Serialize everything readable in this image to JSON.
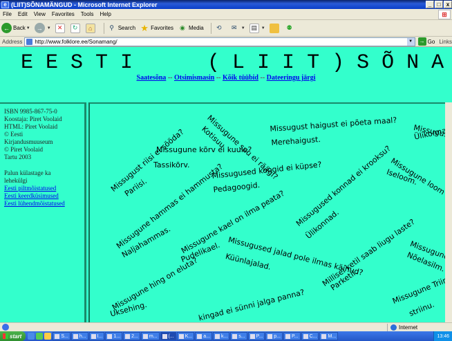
{
  "window": {
    "title": "(LIIT)SÕNAMÄNGUD - Microsoft Internet Explorer",
    "minimize": "_",
    "maximize": "□",
    "close": "x"
  },
  "menu": [
    "File",
    "Edit",
    "View",
    "Favorites",
    "Tools",
    "Help"
  ],
  "toolbar": {
    "back": "Back",
    "search": "Search",
    "favorites": "Favorites",
    "media": "Media"
  },
  "address": {
    "label": "Address",
    "url": "http://www.folklore.ee/Sonamang/",
    "go": "Go",
    "links": "Links"
  },
  "page": {
    "title": "E E S T I      ( L I I T ) S Õ N A M Ä N G U D",
    "nav": [
      {
        "label": "Saatesõna"
      },
      {
        "label": "Otsimismasin"
      },
      {
        "label": "Kõik tüübid"
      },
      {
        "label": "Dateeringu järgi"
      }
    ],
    "nav_separator": " -- "
  },
  "sidebar": {
    "lines": [
      "ISBN 9985-867-75-0",
      "Koostaja: Piret Voolaid",
      "HTML: Piret Voolaid",
      "© Eesti",
      "Kirjandusmuuseum",
      "© Piret Voolaid",
      "Tartu 2003"
    ],
    "note_lines": [
      "Palun külastage ka",
      "lehekülgi"
    ],
    "links": [
      "Eesti piltmõistatused",
      "Eesti keerdküsimused",
      "Eesti lühendmõistatused"
    ]
  },
  "riddles": [
    "Missugust riisi ei sööda?",
    "Pariisi.",
    "Missugune suu ei räägi?",
    "Kotisuu",
    "Missugust haigust ei põeta maal?",
    "Merehaigust.",
    "Missugus",
    "Ülikonnad.",
    "Missugune kõrv ei kuule?",
    "Tassikõrv.",
    "Missugune hammas ei hammusta?",
    "Naljahammas.",
    "Missugused koogid ei küpse?",
    "Pedagoogid.",
    "Missugused konnad ei krooksu?",
    "Ülikonnad.",
    "Missugune loom ei",
    "Iseloom.",
    "Missugune kael on ilma peata?",
    "Pudelikael.",
    "Millisel ketil saab liugu laste?",
    "Parketil.",
    "Missugune s",
    "Nõelasilm.",
    "Missugused jalad pole ilmas käinud?",
    "Küünlajalad.",
    "Missugune hing on eluta?",
    "Uksehing.",
    "kingad ei sünni jalga panna?",
    "Missugune Triin",
    "striinu."
  ],
  "status": {
    "text": "",
    "zone": "Internet"
  },
  "taskbar": {
    "start": "start",
    "tasks": [
      "S...",
      "h...",
      "I...",
      "1...",
      "2...",
      "m...",
      "(...",
      "K...",
      "a...",
      "k...",
      "s...",
      "P...",
      "p...",
      "P...",
      "C...",
      "M..."
    ],
    "clock": "13:46"
  }
}
